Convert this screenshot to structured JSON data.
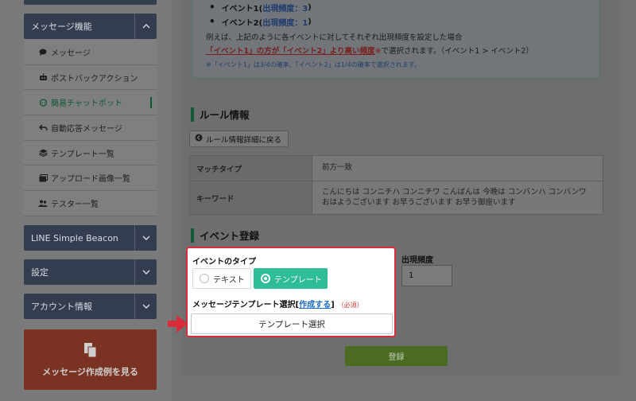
{
  "sidebar": {
    "message_section": "メッセージ機能",
    "items": [
      {
        "label": "メッセージ",
        "icon": "chat-bubble-icon"
      },
      {
        "label": "ポストバックアクション",
        "icon": "robot-icon"
      },
      {
        "label": "簡易チャットボット",
        "icon": "chatbot-icon"
      },
      {
        "label": "自動応答メッセージ",
        "icon": "reply-icon"
      },
      {
        "label": "テンプレート一覧",
        "icon": "layers-icon"
      },
      {
        "label": "アップロード画像一覧",
        "icon": "images-icon"
      },
      {
        "label": "テスター一覧",
        "icon": "users-icon"
      }
    ],
    "beacon_section": "LINE Simple Beacon",
    "settings_section": "設定",
    "account_section": "アカウント情報",
    "cta_label": "メッセージ作成例を見る"
  },
  "info": {
    "event1_prefix": "イベント1(",
    "event1_freq": "出現頻度：3",
    "event1_suffix": ")",
    "event2_prefix": "イベント2(",
    "event2_freq": "出現頻度：1",
    "event2_suffix": ")",
    "example_text": "例えば、上記のように各イベントに対してそれぞれ出現頻度を設定した場合",
    "highlight": "「イベント1」の方が「イベント2」より高い頻度",
    "highlight_mark": "※",
    "highlight_suffix": "で選択されます。（イベント1 > イベント2）",
    "note": "※「イベント1」は3/4の確率、「イベント2」は1/4の確率で選択されます。"
  },
  "rule": {
    "title": "ルール情報",
    "back_button": "ルール情報詳細に戻る",
    "rows": [
      {
        "th": "マッチタイプ",
        "td": "前方一致"
      },
      {
        "th": "キーワード",
        "td": "こんにちは コンニチハ コンニチワ こんばんは 今晩は コンバンハ コンバンワ おはようございます お早うございます お早う御座います"
      }
    ]
  },
  "event": {
    "title": "イベント登録",
    "type_label": "イベントのタイプ",
    "type_options": [
      "テキスト",
      "テンプレート"
    ],
    "type_selected": "テンプレート",
    "template_label_prefix": "メッセージテンプレート選択[",
    "template_label_link": "作成する",
    "template_label_suffix": "]",
    "template_required": "（必須）",
    "template_button": "テンプレート選択",
    "freq_label": "出現頻度",
    "freq_value": "1",
    "submit": "登録"
  }
}
